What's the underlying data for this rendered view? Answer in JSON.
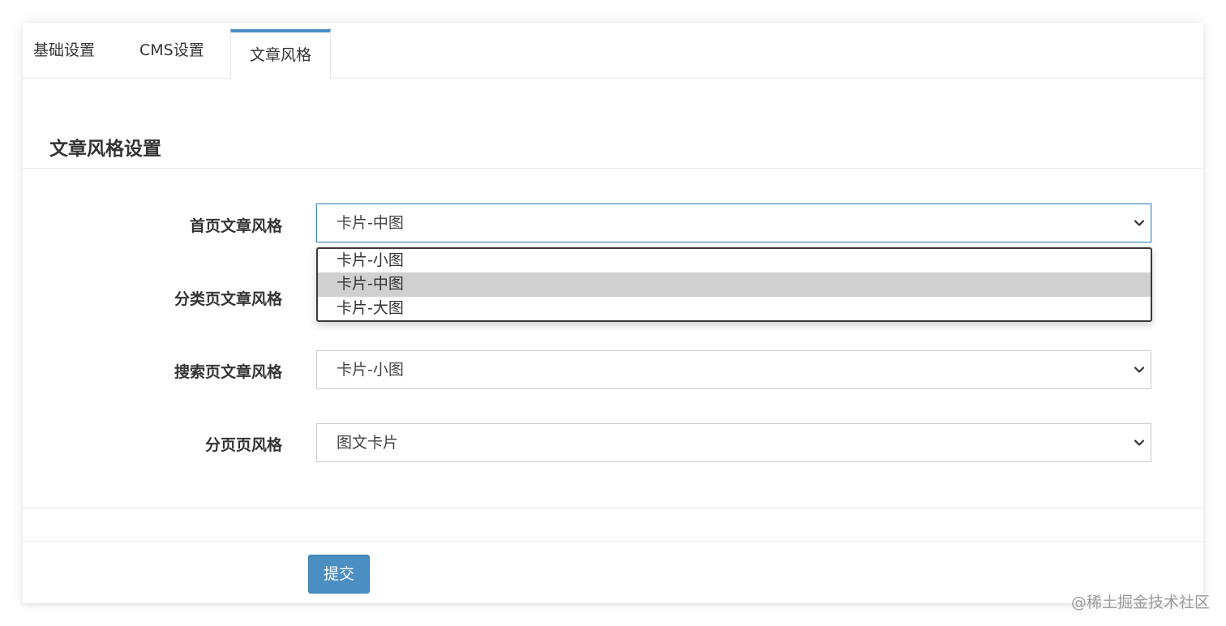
{
  "tabs": [
    {
      "label": "基础设置",
      "active": false
    },
    {
      "label": "CMS设置",
      "active": false
    },
    {
      "label": "文章风格",
      "active": true
    }
  ],
  "section": {
    "title": "文章风格设置"
  },
  "form": {
    "home_style": {
      "label": "首页文章风格",
      "value": "卡片-中图",
      "options": [
        "卡片-小图",
        "卡片-中图",
        "卡片-大图"
      ],
      "open": true
    },
    "category_style": {
      "label": "分类页文章风格"
    },
    "search_style": {
      "label": "搜索页文章风格",
      "value": "卡片-小图"
    },
    "pagination_style": {
      "label": "分页页风格",
      "value": "图文卡片"
    }
  },
  "actions": {
    "submit_label": "提交"
  },
  "watermark": "@稀土掘金技术社区",
  "colors": {
    "accent": "#4a8ec2",
    "option_highlight": "#d0d0d0",
    "text": "#333333"
  }
}
